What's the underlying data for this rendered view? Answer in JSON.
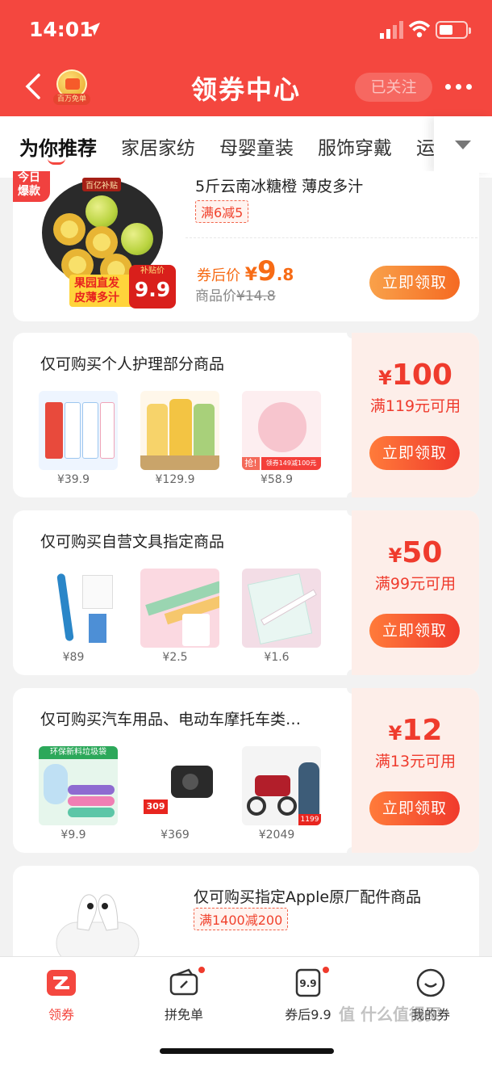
{
  "status": {
    "time": "14:01"
  },
  "header": {
    "badge_text": "百万免单",
    "title": "领券中心",
    "follow_label": "已关注"
  },
  "categories": {
    "items": [
      "为你推荐",
      "家居家纺",
      "母婴童装",
      "服饰穿戴",
      "运"
    ]
  },
  "featured": {
    "hot_label_1": "今日",
    "hot_label_2": "爆款",
    "image_tag_1": "果园直发",
    "image_tag_2": "皮薄多汁",
    "image_subsidy": "百亿补贴",
    "image_price_label": "补贴价",
    "image_price": "9.9",
    "title": "5斤云南冰糖橙 薄皮多汁",
    "chip": "满6减5",
    "after_label": "券后价",
    "after_currency": "¥",
    "after_int": "9",
    "after_dec": ".8",
    "orig_label": "商品价",
    "orig_price": "¥14.8",
    "button": "立即领取"
  },
  "coupons": [
    {
      "title": "仅可购买个人护理部分商品",
      "amount": "100",
      "condition": "满119元可用",
      "button": "立即领取",
      "products": [
        {
          "name": "cotton-swab-pack",
          "price": "¥39.9"
        },
        {
          "name": "shampoo-bottles",
          "price": "¥129.9"
        },
        {
          "name": "face-towel-roll",
          "price": "¥58.9",
          "tag": "抢!",
          "promo": "领券149减100元"
        }
      ]
    },
    {
      "title": "仅可购买自营文具指定商品",
      "amount": "50",
      "condition": "满99元可用",
      "button": "立即领取",
      "products": [
        {
          "name": "blue-pen",
          "price": "¥89"
        },
        {
          "name": "ruler-set",
          "price": "¥2.5"
        },
        {
          "name": "ruler-bag",
          "price": "¥1.6"
        }
      ]
    },
    {
      "title": "仅可购买汽车用品、电动车摩托车类…",
      "amount": "12",
      "condition": "满13元可用",
      "button": "立即领取",
      "products": [
        {
          "name": "trash-bags",
          "price": "¥9.9",
          "banner": "环保新料垃圾袋"
        },
        {
          "name": "dash-cam",
          "price": "¥369",
          "tag": "309"
        },
        {
          "name": "e-scooter",
          "price": "¥2049",
          "tag": "1199"
        }
      ]
    }
  ],
  "apple": {
    "title": "仅可购买指定Apple原厂配件商品",
    "chip": "满1400减200"
  },
  "tabbar": [
    {
      "label": "领券",
      "icon": "coupon-icon",
      "active": true
    },
    {
      "label": "拼免单",
      "icon": "wallet-icon"
    },
    {
      "label": "券后9.9",
      "icon": "ticket-icon",
      "badge": "9.9"
    },
    {
      "label": "我的券",
      "icon": "smile-icon"
    }
  ],
  "currency": "¥",
  "watermark": "值 什么值得买",
  "colors": {
    "brand": "#f4473f",
    "accent": "#ef3b2d",
    "button": "#f56a22"
  }
}
